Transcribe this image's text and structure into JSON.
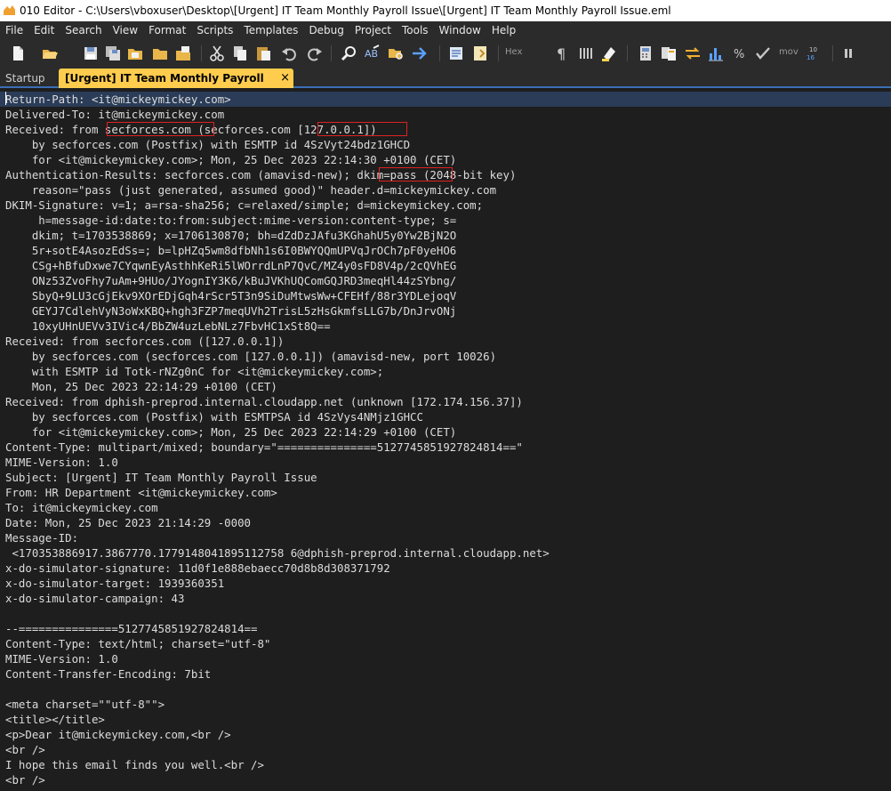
{
  "window": {
    "title": "010 Editor - C:\\Users\\vboxuser\\Desktop\\[Urgent] IT Team Monthly Payroll Issue\\[Urgent] IT Team Monthly Payroll Issue.eml"
  },
  "menu": [
    "File",
    "Edit",
    "Search",
    "View",
    "Format",
    "Scripts",
    "Templates",
    "Debug",
    "Project",
    "Tools",
    "Window",
    "Help"
  ],
  "toolbar": {
    "icons": [
      "new-file-icon",
      "open-file-icon",
      "save-icon",
      "save-all-icon",
      "folder-icon",
      "open-folder-icon",
      "cut-icon",
      "copy-icon",
      "paste-icon",
      "undo-icon",
      "redo-icon",
      "find-icon",
      "replace-icon",
      "find-in-files-icon",
      "goto-icon",
      "template-icon",
      "script-icon",
      "hex-view-icon",
      "paragraph-marks-icon",
      "columns-icon",
      "highlight-icon",
      "calculator-icon",
      "compare-icon",
      "swap-icon",
      "histogram-icon",
      "percent-icon",
      "checksum-icon",
      "move-icon",
      "base-converter-icon",
      "pause-icon"
    ],
    "hex_label": "Hex",
    "mov_label": "mov"
  },
  "tabs": {
    "startup": "Startup",
    "active": "[Urgent] IT Team Monthly Payroll Issue.eml",
    "close": "×"
  },
  "editor": {
    "lines": [
      "Return-Path: <it@mickeymickey.com>",
      "Delivered-To: it@mickeymickey.com",
      "Received: from secforces.com (secforces.com [127.0.0.1])",
      "    by secforces.com (Postfix) with ESMTP id 4SzVyt24bdz1GHCD",
      "    for <it@mickeymickey.com>; Mon, 25 Dec 2023 22:14:30 +0100 (CET)",
      "Authentication-Results: secforces.com (amavisd-new); dkim=pass (2048-bit key)",
      "    reason=\"pass (just generated, assumed good)\" header.d=mickeymickey.com",
      "DKIM-Signature: v=1; a=rsa-sha256; c=relaxed/simple; d=mickeymickey.com;",
      "     h=message-id:date:to:from:subject:mime-version:content-type; s=",
      "    dkim; t=1703538869; x=1706130870; bh=dZdDzJAfu3KGhahU5y0Yw2BjN2O",
      "    5r+sotE4AsozEdSs=; b=lpHZq5wm8dfbNh1s6I0BWYQQmUPVqJrOCh7pF0yeHO6",
      "    CSg+hBfuDxwe7CYqwnEyAsthhKeRi5lWOrrdLnP7QvC/MZ4y0sFD8V4p/2cQVhEG",
      "    ONz53ZvoFhy7uAm+9HUo/JYognIY3K6/kBuJVKhUQComGQJRD3meqHl44zSYbng/",
      "    SbyQ+9LU3cGjEkv9XOrEDjGqh4rScr5T3n9SiDuMtwsWw+CFEHf/88r3YDLejoqV",
      "    GEYJ7CdlehVyN3oWxKBQ+hgh3FZP7meqUVh2TrisL5zHsGkmfsLLG7b/DnJrvONj",
      "    10xyUHnUEVv3IVic4/BbZW4uzLebNLz7FbvHC1xSt8Q==",
      "Received: from secforces.com ([127.0.0.1])",
      "    by secforces.com (secforces.com [127.0.0.1]) (amavisd-new, port 10026)",
      "    with ESMTP id Totk-rNZg0nC for <it@mickeymickey.com>;",
      "    Mon, 25 Dec 2023 22:14:29 +0100 (CET)",
      "Received: from dphish-preprod.internal.cloudapp.net (unknown [172.174.156.37])",
      "    by secforces.com (Postfix) with ESMTPSA id 4SzVys4NMjz1GHCC",
      "    for <it@mickeymickey.com>; Mon, 25 Dec 2023 22:14:29 +0100 (CET)",
      "Content-Type: multipart/mixed; boundary=\"===============5127745851927824814==\"",
      "MIME-Version: 1.0",
      "Subject: [Urgent] IT Team Monthly Payroll Issue",
      "From: HR Department <it@mickeymickey.com>",
      "To: it@mickeymickey.com",
      "Date: Mon, 25 Dec 2023 21:14:29 -0000",
      "Message-ID:",
      " <170353886917.3867770.1779148041895112758 6@dphish-preprod.internal.cloudapp.net>",
      "x-do-simulator-signature: 11d0f1e888ebaecc70d8b8d308371792",
      "x-do-simulator-target: 1939360351",
      "x-do-simulator-campaign: 43",
      "",
      "--===============5127745851927824814==",
      "Content-Type: text/html; charset=\"utf-8\"",
      "MIME-Version: 1.0",
      "Content-Transfer-Encoding: 7bit",
      "",
      "<meta charset=\"\"utf-8\"\">",
      "<title></title>",
      "<p>Dear it@mickeymickey.com,<br />",
      "<br />",
      "I hope this email finds you well.<br />",
      "<br />"
    ]
  },
  "colors": {
    "highlight_border": "#e02020",
    "active_tab": "#ffcc4d",
    "editor_bg": "#1e1e1e"
  }
}
